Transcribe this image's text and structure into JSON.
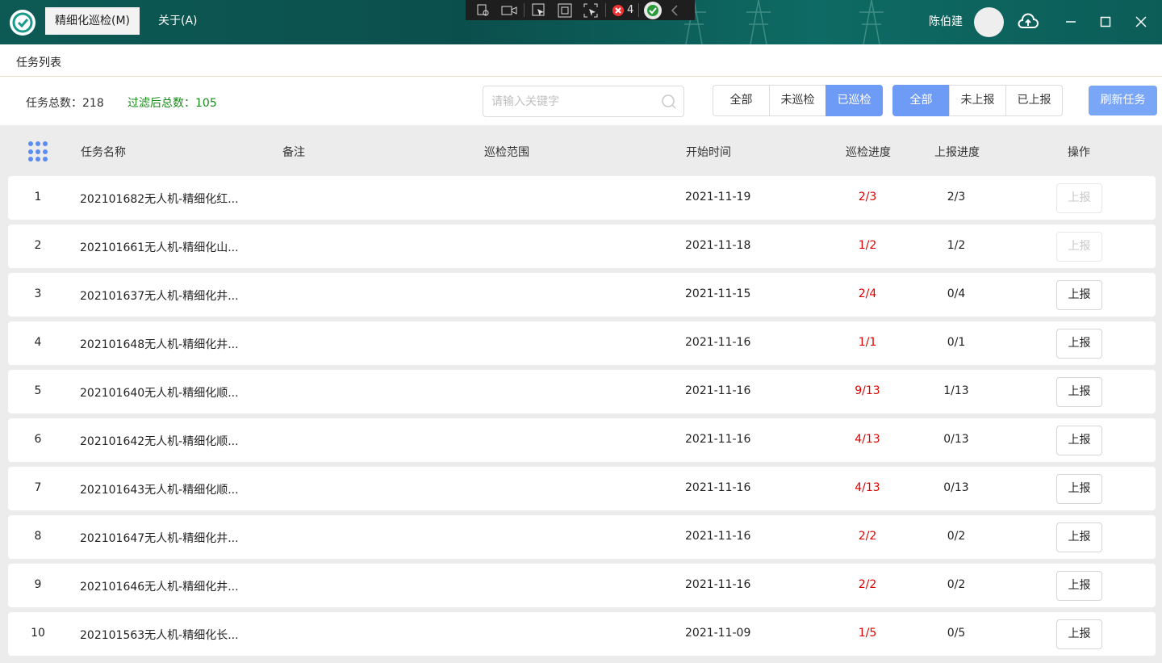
{
  "titlebar": {
    "menus": [
      "精细化巡检(M)",
      "关于(A)"
    ],
    "user_name": "陈伯建",
    "debug_count": "4"
  },
  "subheader": {
    "title": "任务列表"
  },
  "filters": {
    "total_label": "任务总数：218",
    "filtered_label": "过滤后总数：105",
    "search_placeholder": "请输入关键字",
    "inspect_filter": [
      "全部",
      "未巡检",
      "已巡检"
    ],
    "inspect_selected": "已巡检",
    "report_filter": [
      "全部",
      "未上报",
      "已上报"
    ],
    "report_selected": "全部",
    "refresh_label": "刷新任务"
  },
  "table": {
    "headers": [
      "任务名称",
      "备注",
      "巡检范围",
      "开始时间",
      "巡检进度",
      "上报进度",
      "操作"
    ],
    "rows": [
      {
        "index": "1",
        "name": "202101682无人机-精细化红...",
        "note": "",
        "range": "",
        "date": "2021-11-19",
        "inspect": "2/3",
        "report": "2/3",
        "action": "上报",
        "action_enabled": false
      },
      {
        "index": "2",
        "name": "202101661无人机-精细化山...",
        "note": "",
        "range": "",
        "date": "2021-11-18",
        "inspect": "1/2",
        "report": "1/2",
        "action": "上报",
        "action_enabled": false
      },
      {
        "index": "3",
        "name": "202101637无人机-精细化井...",
        "note": "",
        "range": "",
        "date": "2021-11-15",
        "inspect": "2/4",
        "report": "0/4",
        "action": "上报",
        "action_enabled": true
      },
      {
        "index": "4",
        "name": "202101648无人机-精细化井...",
        "note": "",
        "range": "",
        "date": "2021-11-16",
        "inspect": "1/1",
        "report": "0/1",
        "action": "上报",
        "action_enabled": true
      },
      {
        "index": "5",
        "name": "202101640无人机-精细化顺...",
        "note": "",
        "range": "",
        "date": "2021-11-16",
        "inspect": "9/13",
        "report": "1/13",
        "action": "上报",
        "action_enabled": true
      },
      {
        "index": "6",
        "name": "202101642无人机-精细化顺...",
        "note": "",
        "range": "",
        "date": "2021-11-16",
        "inspect": "4/13",
        "report": "0/13",
        "action": "上报",
        "action_enabled": true
      },
      {
        "index": "7",
        "name": "202101643无人机-精细化顺...",
        "note": "",
        "range": "",
        "date": "2021-11-16",
        "inspect": "4/13",
        "report": "0/13",
        "action": "上报",
        "action_enabled": true
      },
      {
        "index": "8",
        "name": "202101647无人机-精细化井...",
        "note": "",
        "range": "",
        "date": "2021-11-16",
        "inspect": "2/2",
        "report": "0/2",
        "action": "上报",
        "action_enabled": true
      },
      {
        "index": "9",
        "name": "202101646无人机-精细化井...",
        "note": "",
        "range": "",
        "date": "2021-11-16",
        "inspect": "2/2",
        "report": "0/2",
        "action": "上报",
        "action_enabled": true
      },
      {
        "index": "10",
        "name": "202101563无人机-精细化长...",
        "note": "",
        "range": "",
        "date": "2021-11-09",
        "inspect": "1/5",
        "report": "0/5",
        "action": "上报",
        "action_enabled": true
      }
    ]
  },
  "colors": {
    "titlebar": "#0d5a55",
    "accent": "#6e9bf5",
    "progress_red": "#e00000",
    "filtered_green": "#1a8a1a"
  }
}
